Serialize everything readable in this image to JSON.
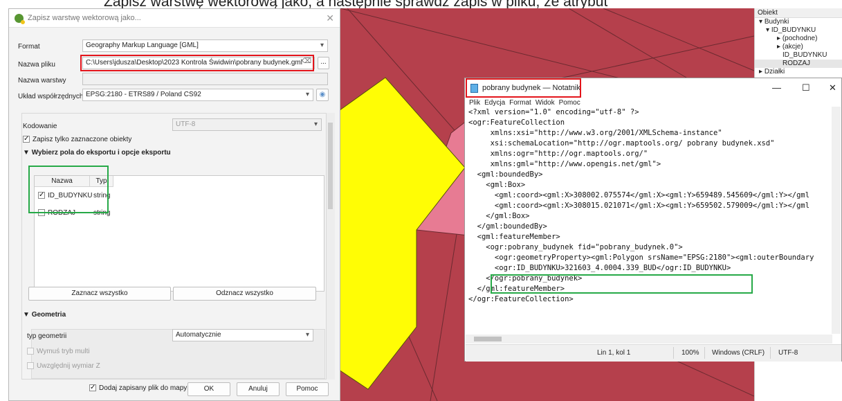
{
  "caption_fragment": "Zapisz warstwę wektorową jako, a następnie sprawdź zapis w pliku, że atrybut",
  "dialog": {
    "title": "Zapisz warstwę wektorową jako...",
    "format_label": "Format",
    "format_value": "Geography Markup Language [GML]",
    "filename_label": "Nazwa pliku",
    "filename_value": "C:\\Users\\jdusza\\Desktop\\2023 Kontrola Świdwin\\pobrany budynek.gml",
    "browse_label": "...",
    "layername_label": "Nazwa warstwy",
    "layername_value": "",
    "crs_label": "Układ współrzędnych",
    "crs_value": "EPSG:2180 - ETRS89 / Poland CS92",
    "encoding_label": "Kodowanie",
    "encoding_value": "UTF-8",
    "only_selected_label": "Zapisz tylko zaznaczone obiekty",
    "fields_section": "Wybierz pola do eksportu i opcje eksportu",
    "table_headers": [
      "Nazwa",
      "Typ"
    ],
    "table_rows": [
      {
        "checked": true,
        "name": "ID_BUDYNKU",
        "type": "string"
      },
      {
        "checked": false,
        "name": "RODZAJ",
        "type": "string"
      }
    ],
    "select_all": "Zaznacz wszystko",
    "deselect_all": "Odznacz wszystko",
    "geometry_section": "Geometria",
    "geometry_type_label": "typ geometrii",
    "geometry_type_value": "Automatycznie",
    "force_multi_label": "Wymuś tryb multi",
    "include_z_label": "Uwzględnij wymiar Z",
    "add_to_map_label": "Dodaj zapisany plik do mapy",
    "ok": "OK",
    "cancel": "Anuluj",
    "help": "Pomoc"
  },
  "identify": {
    "header": "Obiekt",
    "rows": [
      "Budynki",
      "ID_BUDYNKU",
      "(pochodne)",
      "(akcje)",
      "ID_BUDYNKU",
      "RODZAJ",
      "Działki"
    ]
  },
  "notepad": {
    "title": "pobrany budynek — Notatnik",
    "menu": [
      "Plik",
      "Edycja",
      "Format",
      "Widok",
      "Pomoc"
    ],
    "lines": [
      "<?xml version=\"1.0\" encoding=\"utf-8\" ?>",
      "<ogr:FeatureCollection",
      "     xmlns:xsi=\"http://www.w3.org/2001/XMLSchema-instance\"",
      "     xsi:schemaLocation=\"http://ogr.maptools.org/ pobrany budynek.xsd\"",
      "     xmlns:ogr=\"http://ogr.maptools.org/\"",
      "     xmlns:gml=\"http://www.opengis.net/gml\">",
      "  <gml:boundedBy>",
      "    <gml:Box>",
      "      <gml:coord><gml:X>308002.075574</gml:X><gml:Y>659489.545609</gml:Y></gml",
      "      <gml:coord><gml:X>308015.021071</gml:X><gml:Y>659502.579009</gml:Y></gml",
      "    </gml:Box>",
      "  </gml:boundedBy>",
      "",
      "  <gml:featureMember>",
      "    <ogr:pobrany_budynek fid=\"pobrany_budynek.0\">",
      "      <ogr:geometryProperty><gml:Polygon srsName=\"EPSG:2180\"><gml:outerBoundary",
      "      <ogr:ID_BUDYNKU>321603_4.0004.339_BUD</ogr:ID_BUDYNKU>",
      "    </ogr:pobrany_budynek>",
      "  </gml:featureMember>",
      "</ogr:FeatureCollection>"
    ],
    "status_pos": "Lin 1, kol 1",
    "status_zoom": "100%",
    "status_eol": "Windows (CRLF)",
    "status_enc": "UTF-8"
  }
}
